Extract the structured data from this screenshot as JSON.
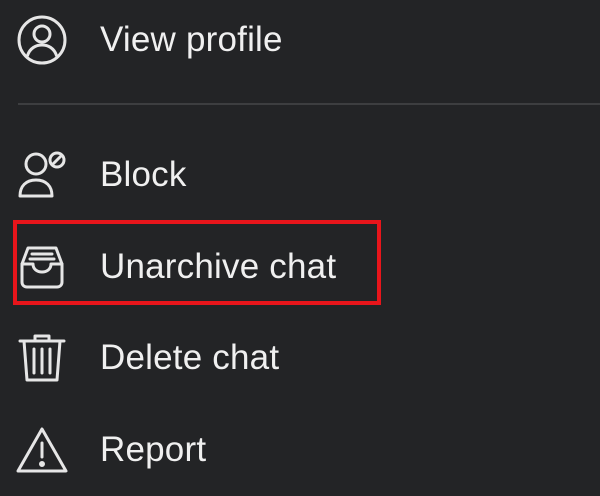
{
  "menu": {
    "items": [
      {
        "id": "view-profile",
        "label": "View profile",
        "icon": "user-circle-icon"
      },
      {
        "id": "block",
        "label": "Block",
        "icon": "user-block-icon"
      },
      {
        "id": "unarchive-chat",
        "label": "Unarchive chat",
        "icon": "unarchive-icon"
      },
      {
        "id": "delete-chat",
        "label": "Delete chat",
        "icon": "trash-icon"
      },
      {
        "id": "report",
        "label": "Report",
        "icon": "warning-icon"
      }
    ]
  },
  "colors": {
    "background": "#232426",
    "text": "#f0f0f0",
    "divider": "#3d3e40",
    "highlight": "#e8151b"
  }
}
